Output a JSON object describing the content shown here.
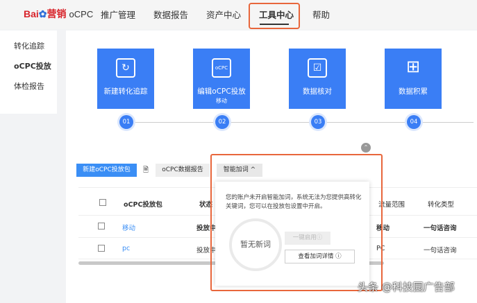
{
  "nav": {
    "logo": "Bai du 营销",
    "logo_sub": "oCPC",
    "items": [
      "推广管理",
      "数据报告",
      "资产中心",
      "工具中心",
      "帮助"
    ],
    "active": "工具中心"
  },
  "sidebar": {
    "items": [
      "转化追踪",
      "oCPC投放",
      "体检报告"
    ],
    "active": "oCPC投放"
  },
  "cards": [
    {
      "label": "新建转化追踪",
      "icon": "↻",
      "step": "01"
    },
    {
      "label": "编辑oCPC投放",
      "sub": "移动",
      "icon": "oCPC",
      "step": "02"
    },
    {
      "label": "数据核对",
      "icon": "☑",
      "step": "03"
    },
    {
      "label": "数据积累",
      "icon": "⊞",
      "step": "04"
    }
  ],
  "toolbar": {
    "new": "新建oCPC投放包",
    "report": "oCPC数据报告",
    "smart": "智能加词 ^"
  },
  "table": {
    "headers": [
      "oCPC投放包",
      "状态",
      "流量范围",
      "转化类型"
    ],
    "rows": [
      {
        "name": "移动",
        "status": "投放中",
        "range": "移动",
        "type": "一句话咨询"
      },
      {
        "name": "pc",
        "status": "投放中",
        "range": "PC",
        "type": "一句话咨询"
      }
    ]
  },
  "popup": {
    "text": "您的账户未开启智能加词，系统无法为您提供高转化关键词，您可以在投放包设置中开启。",
    "empty": "暂无新词",
    "apply": "一键启用",
    "details": "查看加词详情"
  },
  "watermark": "头条 @科技园广告部",
  "colors": {
    "primary": "#3a7ef5",
    "highlight": "#e8663b"
  }
}
